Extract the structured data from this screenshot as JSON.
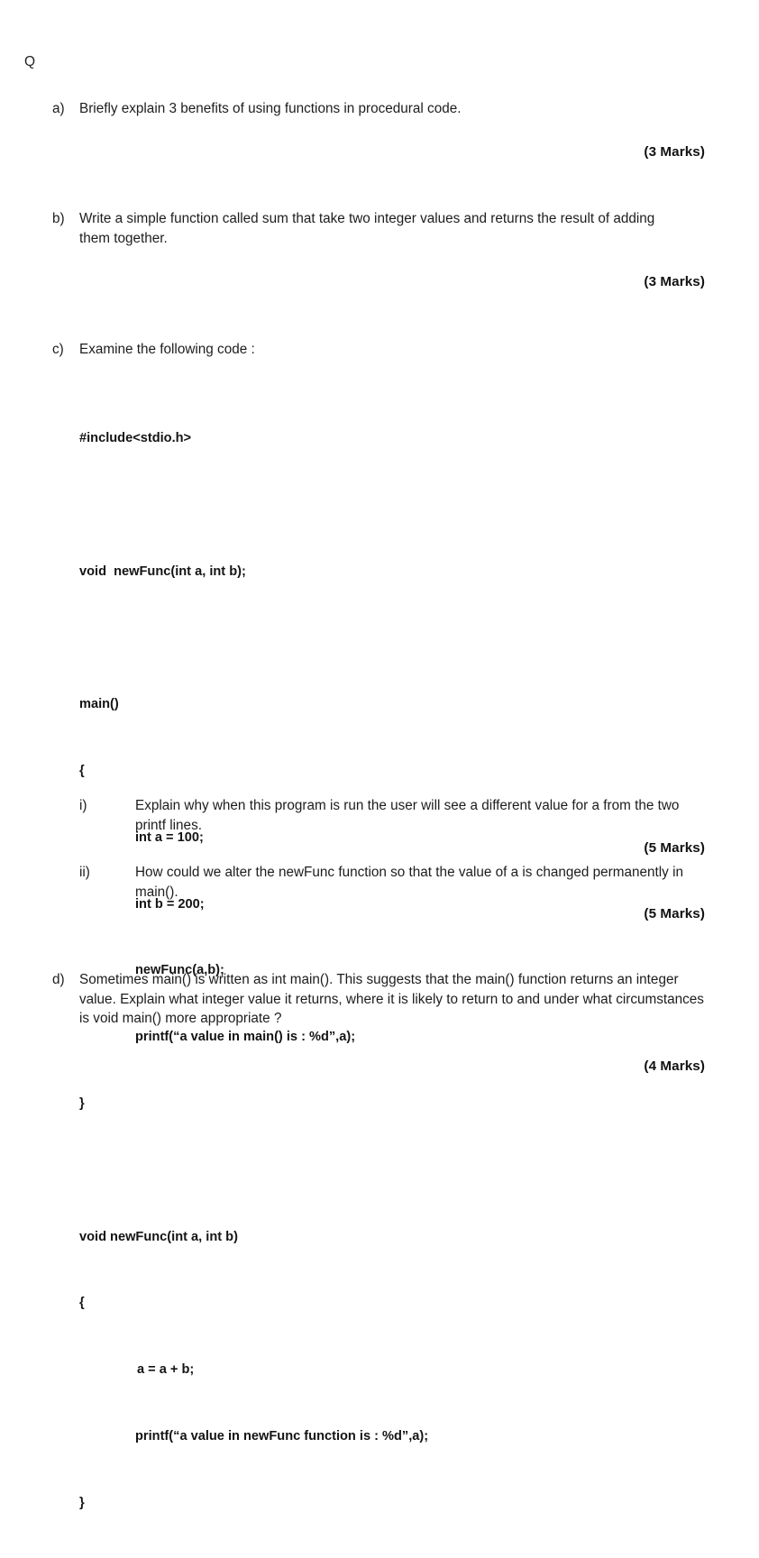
{
  "page": {
    "header_marker": "Q",
    "marks_a": "(3 Marks)",
    "marks_b": "(3 Marks)",
    "marks_i": "(5 Marks)",
    "marks_ii": "(5 Marks)",
    "marks_d": "(4 Marks)"
  },
  "questions": {
    "a": {
      "label": "a)",
      "text": "Briefly explain 3 benefits of using functions in procedural code."
    },
    "b": {
      "label": "b)",
      "text": "Write a simple function called sum that take two integer values and returns the result of adding them together."
    },
    "c": {
      "label": "c)",
      "text": "Examine the following code :",
      "sub_i": {
        "label": "i)",
        "text": "Explain why when this program is run the user will see a different value for a from the two printf lines."
      },
      "sub_ii": {
        "label": "ii)",
        "text": "How could we alter the newFunc function so that the value of a is changed permanently in main()."
      }
    },
    "d": {
      "label": "d)",
      "text": "Sometimes main() is written as int main().  This suggests that the main() function returns an integer value.  Explain what integer value it returns, where it is likely to return to and under what circumstances is void main() more appropriate ?"
    }
  },
  "code_listing": {
    "line_01": "#include<stdio.h>",
    "line_02": "void  newFunc(int a, int b);",
    "line_03": "main()",
    "line_04": "{",
    "line_05": "int a = 100;",
    "line_06": "int b = 200;",
    "line_07": "newFunc(a,b);",
    "line_08": "printf(“a value in main() is : %d”,a);",
    "line_09": "}",
    "line_10": "void newFunc(int a, int b)",
    "line_11": "{",
    "line_12": "a = a + b;",
    "line_13": "printf(“a value in newFunc function is : %d”,a);",
    "line_14": "}"
  }
}
